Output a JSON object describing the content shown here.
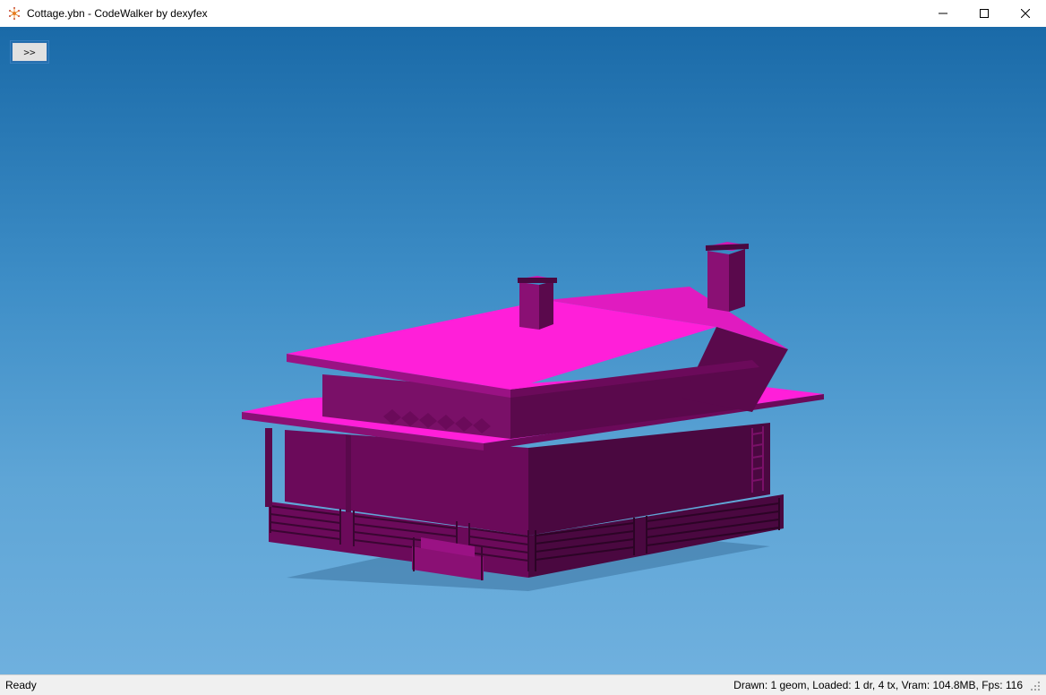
{
  "window": {
    "title": "Cottage.ybn - CodeWalker by dexyfex"
  },
  "controls": {
    "minimize": "─",
    "maximize": "☐",
    "close": "✕"
  },
  "viewport": {
    "toggle_label": ">>"
  },
  "status": {
    "left_text": "Ready",
    "right_text": "Drawn: 1 geom, Loaded: 1 dr, 4 tx, Vram: 104.8MB, Fps: 116"
  },
  "colors": {
    "model_light": "#ff1fd9",
    "model_mid": "#d018b2",
    "model_dark": "#6b0a5a",
    "model_darkest": "#4a0840"
  }
}
